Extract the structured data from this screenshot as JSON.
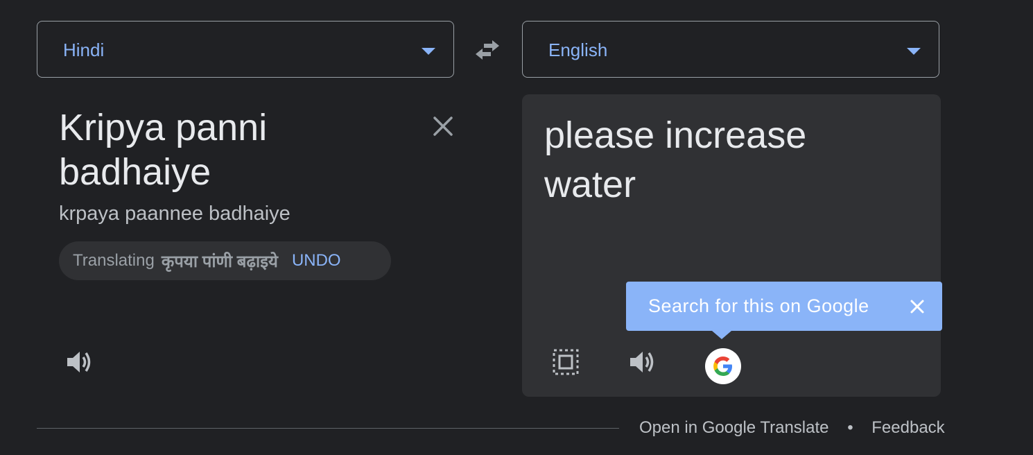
{
  "source": {
    "language": "Hindi",
    "text": "Kripya panni badhaiye",
    "transliteration": "krpaya paannee badhaiye",
    "translating_prefix": "Translating",
    "translating_word": "कृपया पांणी बढ़ाइये",
    "undo_label": "UNDO"
  },
  "target": {
    "language": "English",
    "text": "please increase water"
  },
  "tooltip": {
    "text": "Search for this on Google"
  },
  "footer": {
    "open_link": "Open in Google Translate",
    "separator": "•",
    "feedback_link": "Feedback"
  },
  "colors": {
    "background": "#202124",
    "panel": "#303134",
    "accent": "#8ab4f8",
    "text": "#e8eaed"
  },
  "icons": [
    "chevron-down-icon",
    "swap-icon",
    "close-icon",
    "speaker-icon",
    "select-all-icon",
    "google-g-icon"
  ]
}
